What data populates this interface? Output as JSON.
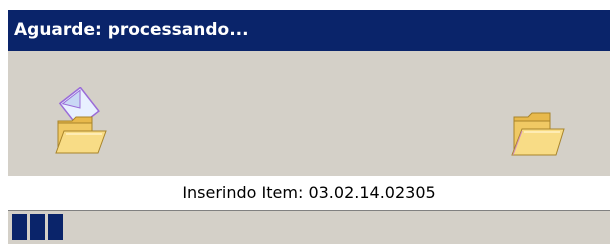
{
  "window": {
    "title": "Aguarde: processando..."
  },
  "animation": {
    "source_icon": "open-folder-with-document-icon",
    "target_icon": "open-folder-icon"
  },
  "status": {
    "text": "Inserindo Item: 03.02.14.02305"
  },
  "progress": {
    "filled_blocks": 3
  },
  "colors": {
    "titlebar": "#0a246a",
    "dialog_face": "#d4d0c8",
    "progress_fill": "#0a246a",
    "folder_yellow": "#f5d77a"
  }
}
